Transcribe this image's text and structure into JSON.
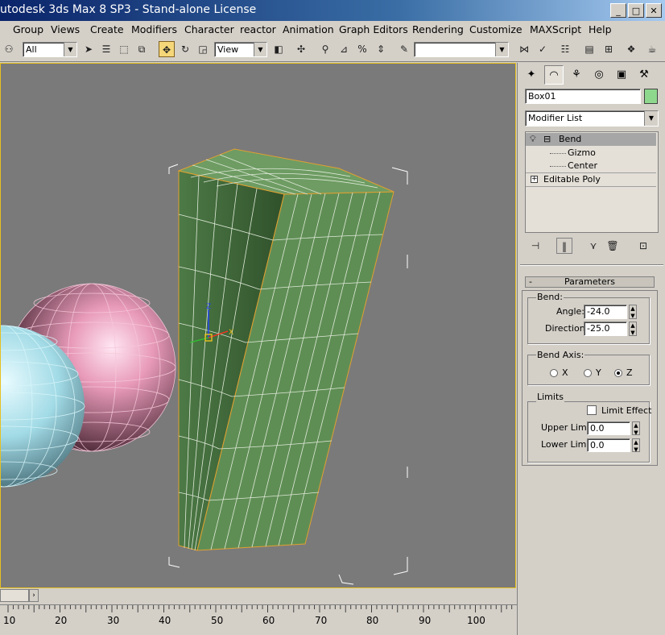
{
  "window": {
    "title": "utodesk 3ds Max 8 SP3  - Stand-alone License",
    "minimize": "_",
    "maximize": "□",
    "close": "✕"
  },
  "menu": [
    "Group",
    "Views",
    "Create",
    "Modifiers",
    "Character",
    "reactor",
    "Animation",
    "Graph Editors",
    "Rendering",
    "Customize",
    "MAXScript",
    "Help"
  ],
  "toolbar": {
    "selection_filter": "All",
    "reference_coord": "View",
    "named_selection": ""
  },
  "panel": {
    "object_name": "Box01",
    "object_color": "#8ed88e",
    "modifier_list": "Modifier List",
    "stack": [
      {
        "label": "Bend",
        "expander": "⊟"
      },
      {
        "label": "Gizmo"
      },
      {
        "label": "Center"
      },
      {
        "label": "Editable Poly",
        "expander": "+"
      }
    ],
    "rollout_title": "Parameters",
    "bend_group": "Bend:",
    "angle_label": "Angle:",
    "angle_value": "-24.0",
    "direction_label": "Direction:",
    "direction_value": "-25.0",
    "bend_axis_group": "Bend Axis:",
    "axis_x": "X",
    "axis_y": "Y",
    "axis_z": "Z",
    "selected_axis": "Z",
    "limits_group": "Limits",
    "limit_effect": "Limit Effect",
    "limit_effect_checked": false,
    "upper_limit_label": "Upper Limit:",
    "upper_limit_value": "0.0",
    "lower_limit_label": "Lower Limit:",
    "lower_limit_value": "0.0"
  },
  "timeline": {
    "ticks": [
      "10",
      "20",
      "30",
      "40",
      "50",
      "60",
      "70",
      "80",
      "90",
      "100"
    ]
  },
  "colors": {
    "viewport_bg": "#7a7a7a",
    "box_green": "#5f8e55",
    "sphere_pink": "#e49ab4",
    "sphere_cyan": "#a6dde6",
    "active_border": "#e8c020"
  }
}
